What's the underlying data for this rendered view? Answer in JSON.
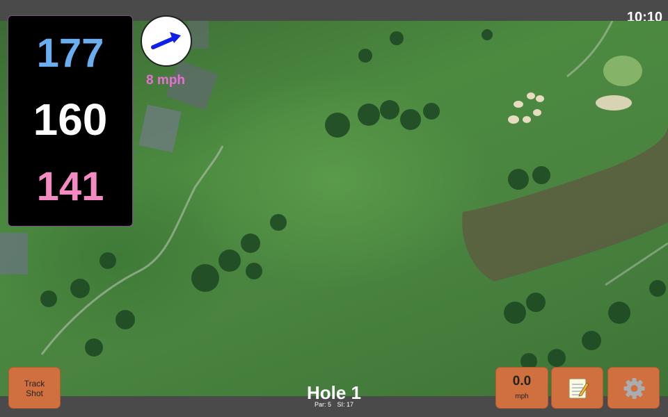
{
  "status": {
    "time": "10:10"
  },
  "yardage": {
    "back": "177",
    "center": "160",
    "front": "141"
  },
  "wind": {
    "speed": "8 mph",
    "direction_icon": "arrow-icon"
  },
  "hole": {
    "title": "Hole 1",
    "par": "Par: 5",
    "stroke_index": "SI: 17"
  },
  "buttons": {
    "track_shot_line1": "Track",
    "track_shot_line2": "Shot",
    "speed_value": "0.0",
    "speed_unit": "mph",
    "notes_icon": "notepad-icon",
    "settings_icon": "gear-icon"
  },
  "colors": {
    "yard_back": "#6aaef0",
    "yard_front": "#f48ac2",
    "wind_text": "#e96fd5",
    "button_bg": "#d0703f"
  }
}
